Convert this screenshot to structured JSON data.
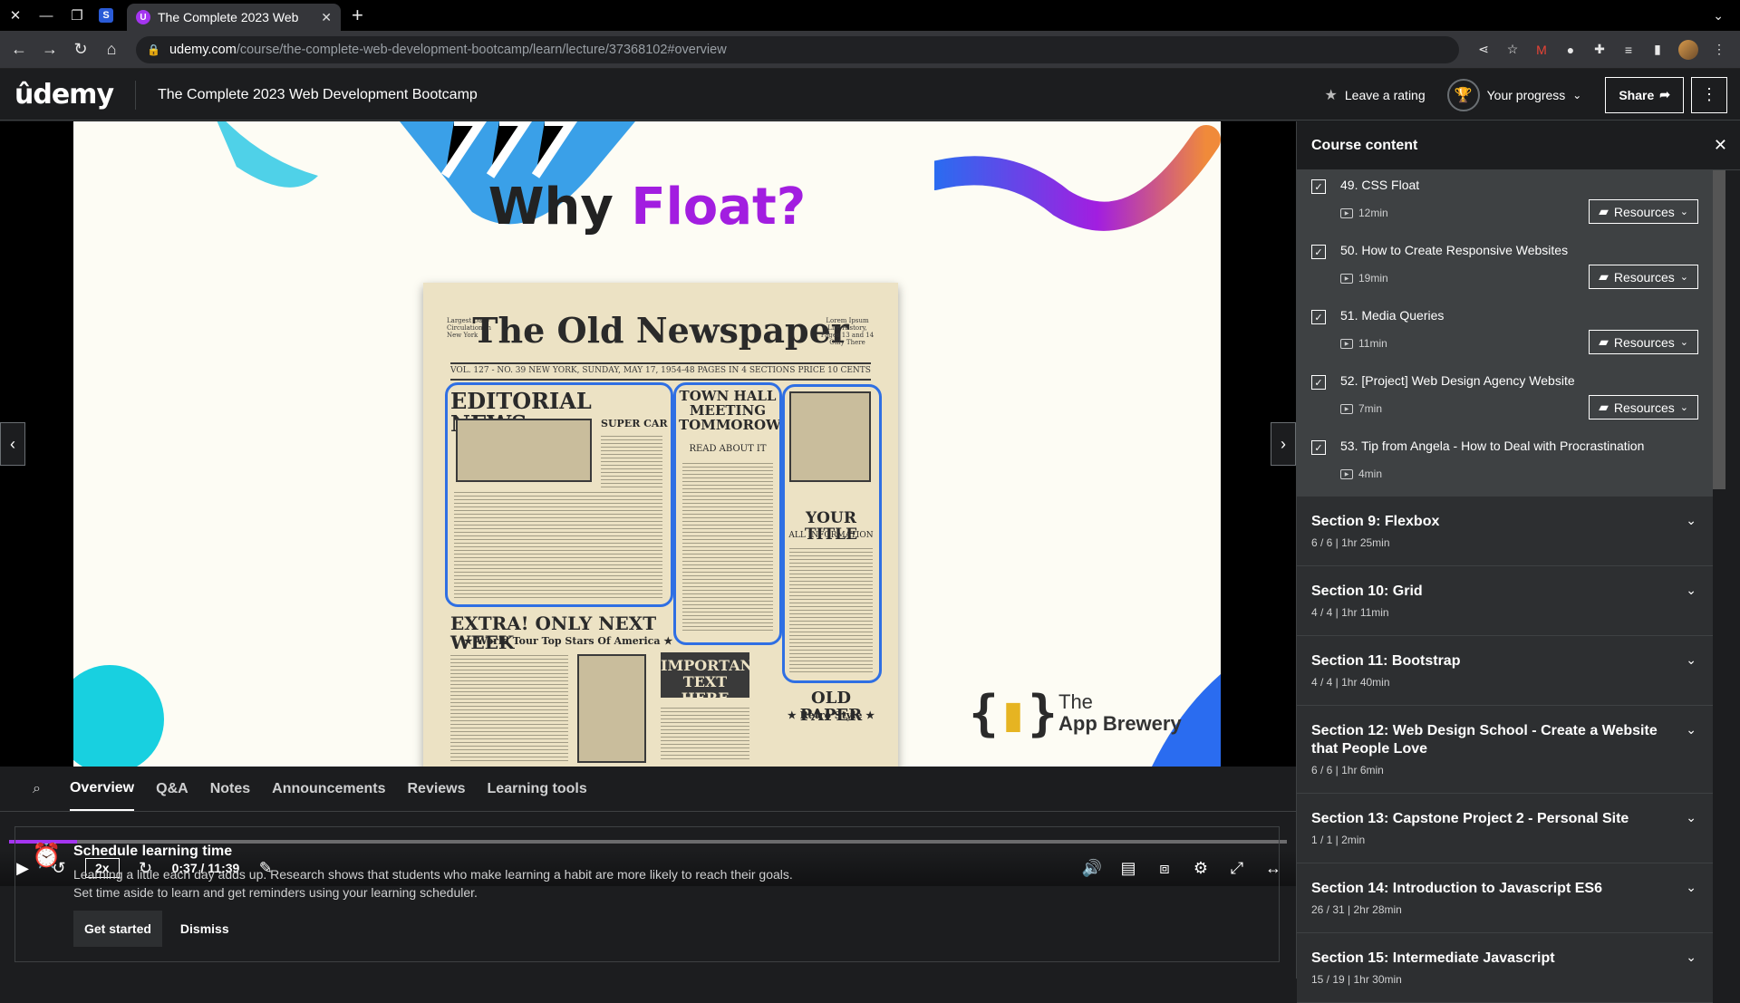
{
  "browser": {
    "tab_title": "The Complete 2023 Web",
    "tab_close": "✕",
    "url_host": "udemy.com",
    "url_path": "/course/the-complete-web-development-bootcamp/learn/lecture/37368102#overview"
  },
  "header": {
    "logo": "ûdemy",
    "course_title": "The Complete 2023 Web Development Bootcamp",
    "rating_label": "Leave a rating",
    "progress_label": "Your progress",
    "share_label": "Share"
  },
  "slide": {
    "title_main": "Why ",
    "title_accent": "Float?",
    "masthead": "The Old Newspaper",
    "np_left_meta": "Largest Daily Circulation In New York",
    "np_right_meta": "Lorem Ipsum Life History, Pages 13 and 14 Only There",
    "np_sub_left": "VOL. 127 - NO. 39",
    "np_sub_center": "NEW YORK, SUNDAY, MAY 17, 1954-48 PAGES IN 4 SECTIONS",
    "np_sub_right": "PRICE 10 CENTS",
    "editorial": "EDITORIAL NEWS",
    "super_car": "SUPER CAR",
    "town_hall": "TOWN HALL MEETING TOMMOROW",
    "read_about": "READ ABOUT IT",
    "your_title": "YOUR TITLE",
    "all_info": "ALL INFORMATION",
    "extra": "EXTRA! ONLY NEXT WEEK",
    "world_tour": "★ World Tour Top Stars Of America ★",
    "important": "IMPORTANT TEXT HERE",
    "old_paper": "OLD PAPER",
    "retro": "★ Retro Style ★",
    "brand_the": "The",
    "brand_name": "App Brewery"
  },
  "player": {
    "speed": "2x",
    "time": "0:37 / 11:39",
    "progress_fraction": 0.053
  },
  "tabs": [
    "Overview",
    "Q&A",
    "Notes",
    "Announcements",
    "Reviews",
    "Learning tools"
  ],
  "schedule": {
    "title": "Schedule learning time",
    "body_1": "Learning a little each day adds up. Research shows that students who make learning a habit are more likely to reach their goals.",
    "body_2": "Set time aside to learn and get reminders using your learning scheduler.",
    "get_started": "Get started",
    "dismiss": "Dismiss"
  },
  "sidebar": {
    "title": "Course content",
    "resources_label": "Resources",
    "lectures": [
      {
        "title": "49. CSS Float",
        "duration": "12min",
        "resources": true
      },
      {
        "title": "50. How to Create Responsive Websites",
        "duration": "19min",
        "resources": true
      },
      {
        "title": "51. Media Queries",
        "duration": "11min",
        "resources": true
      },
      {
        "title": "52. [Project] Web Design Agency Website",
        "duration": "7min",
        "resources": true
      },
      {
        "title": "53. Tip from Angela - How to Deal with Procrastination",
        "duration": "4min",
        "resources": false
      }
    ],
    "sections": [
      {
        "title": "Section 9: Flexbox",
        "meta": "6 / 6 | 1hr 25min"
      },
      {
        "title": "Section 10: Grid",
        "meta": "4 / 4 | 1hr 11min"
      },
      {
        "title": "Section 11: Bootstrap",
        "meta": "4 / 4 | 1hr 40min"
      },
      {
        "title": "Section 12: Web Design School - Create a Website that People Love",
        "meta": "6 / 6 | 1hr 6min"
      },
      {
        "title": "Section 13: Capstone Project 2 - Personal Site",
        "meta": "1 / 1 | 2min"
      },
      {
        "title": "Section 14: Introduction to Javascript ES6",
        "meta": "26 / 31 | 2hr 28min"
      },
      {
        "title": "Section 15: Intermediate Javascript",
        "meta": "15 / 19 | 1hr 30min"
      }
    ]
  }
}
